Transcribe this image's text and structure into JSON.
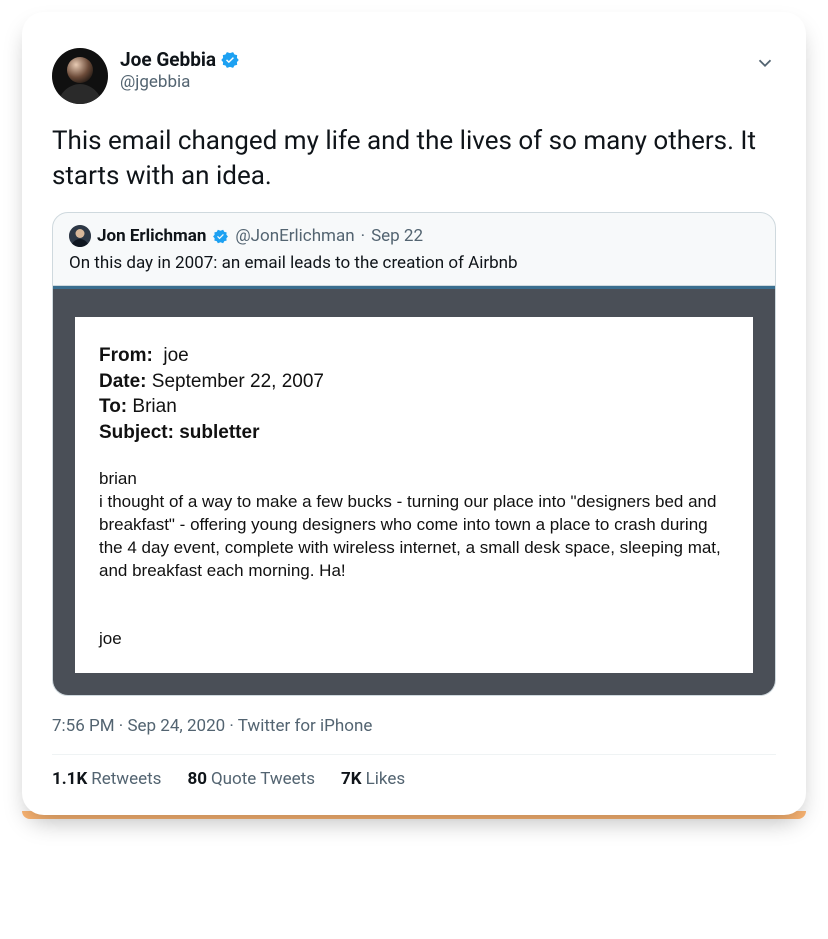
{
  "tweet": {
    "author": {
      "display_name": "Joe Gebbia",
      "handle": "@jgebbia",
      "verified": true
    },
    "text": "This email changed my life and the lives of so many others. It starts with an idea.",
    "timestamp": "7:56 PM · Sep 24, 2020",
    "source": "Twitter for iPhone",
    "stats": {
      "retweets_count": "1.1K",
      "retweets_label": "Retweets",
      "quotes_count": "80",
      "quotes_label": "Quote Tweets",
      "likes_count": "7K",
      "likes_label": "Likes"
    }
  },
  "quoted": {
    "author": {
      "display_name": "Jon Erlichman",
      "handle": "@JonErlichman",
      "verified": true,
      "date": "Sep 22"
    },
    "text": "On this day in 2007: an email leads to the creation of Airbnb"
  },
  "email": {
    "from_label": "From:",
    "from_value": "joe",
    "date_label": "Date:",
    "date_value": "September 22, 2007",
    "to_label": "To:",
    "to_value": "Brian",
    "subject_label": "Subject:",
    "subject_value": "subletter",
    "greeting": "brian",
    "body": "i thought of a way to make a few bucks - turning our place into \"designers bed and breakfast\" - offering young designers who come into town a place to crash during the 4 day event, complete with wireless internet, a small desk space, sleeping mat, and breakfast each morning. Ha!",
    "signature": "joe"
  },
  "icons": {
    "verified": "verified-badge",
    "chevron": "chevron-down"
  }
}
